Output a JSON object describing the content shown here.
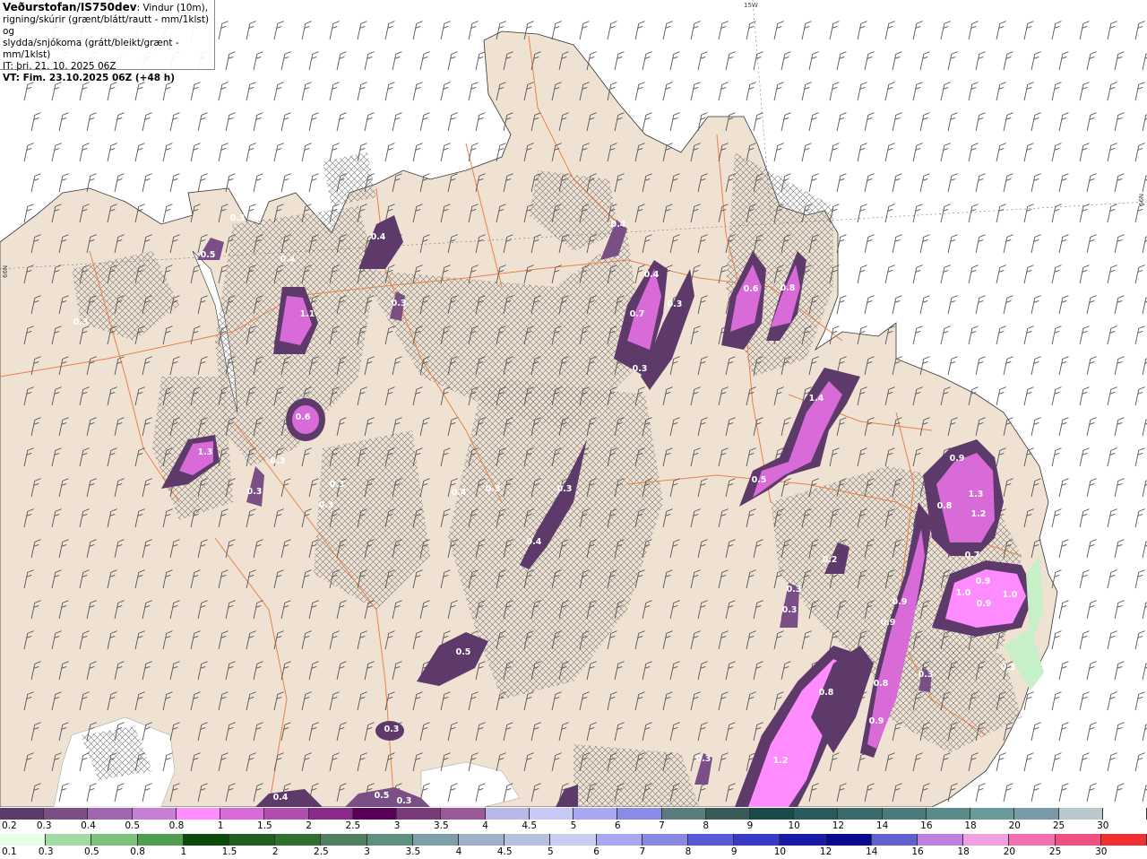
{
  "header": {
    "brand": "Veðurstofan/IS750dev",
    "desc1": ": Vindur (10m),",
    "desc2": "rigning/skúrir (grænt/blátt/rautt - mm/1klst) og",
    "desc3": "slydda/snjókoma (grátt/bleikt/grænt - mm/1klst)",
    "it": "IT: þri. 21. 10. 2025 06Z",
    "vt": "VT: Fim. 23.10.2025 06Z (+48 h)"
  },
  "map": {
    "land_color": "#f0e2d3",
    "sea_color": "#ffffff",
    "road_color": "#e8804a",
    "graticule_labels": {
      "lon": "15W",
      "lat_left": "66N",
      "lat_right": "66N"
    },
    "precip_values": [
      "0.4",
      "0.5",
      "0.3",
      "0.4",
      "1.1",
      "0.3",
      "0.6",
      "1.3",
      "0.3",
      "0.3",
      "0.3",
      "0.3",
      "0.3",
      "0.3",
      "0.4",
      "0.4",
      "0.3",
      "0.4",
      "0.7",
      "0.3",
      "0.3",
      "0.4",
      "0.6",
      "0.8",
      "1.4",
      "0.5",
      "0.9",
      "0.8",
      "1.3",
      "1.2",
      "0.7",
      "0.2",
      "0.3",
      "0.3",
      "0.9",
      "1.0",
      "0.9",
      "1.0",
      "0.9",
      "0.9",
      "0.8",
      "0.9",
      "0.8",
      "0.3",
      "1.2",
      "0.3",
      "0.4",
      "0.5",
      "0.5",
      "0.3",
      "0.3",
      "0.3"
    ]
  },
  "legend_snow": {
    "labels": [
      "0.2",
      "0.3",
      "0.4",
      "0.5",
      "0.8",
      "1",
      "1.5",
      "2",
      "2.5",
      "3",
      "3.5",
      "4",
      "4.5",
      "5",
      "6",
      "7",
      "8",
      "9",
      "10",
      "12",
      "14",
      "16",
      "18",
      "20",
      "25",
      "30"
    ],
    "colors": [
      "#5e3a6a",
      "#7a4f86",
      "#a066b0",
      "#c77fd3",
      "#ff8cff",
      "#d96bd9",
      "#b04fb0",
      "#8a2a8a",
      "#5a005a",
      "#7a3a7a",
      "#9a5a9a",
      "#b7b7e8",
      "#c8c8f4",
      "#a8a8f0",
      "#8a8ae8",
      "#5b7c7c",
      "#3a5a5a",
      "#1a4a4a",
      "#2a5a5a",
      "#3a6a6a",
      "#4a7a7a",
      "#5a8a8a",
      "#6a9a9a",
      "#7a9aa6",
      "#b8c8cc",
      "#ffffff"
    ]
  },
  "legend_rain": {
    "labels": [
      "0.1",
      "0.3",
      "0.5",
      "0.8",
      "1",
      "1.5",
      "2",
      "2.5",
      "3",
      "3.5",
      "4",
      "4.5",
      "5",
      "6",
      "7",
      "8",
      "9",
      "10",
      "12",
      "14",
      "16",
      "18",
      "20",
      "25",
      "30"
    ],
    "colors": [
      "#e6ffe6",
      "#a3dca3",
      "#7cc27c",
      "#4f9f4f",
      "#0a4a0a",
      "#1f5f1f",
      "#2f6f2f",
      "#4f7f5f",
      "#5f8f7f",
      "#7f9fa8",
      "#9fb0c8",
      "#b8c0e0",
      "#c8ccf0",
      "#a8a8f0",
      "#8888e0",
      "#5a5ad8",
      "#3a3ac8",
      "#1a1aa8",
      "#0a0a90",
      "#6060d0",
      "#c080e0",
      "#f0a0e0",
      "#f070b0",
      "#f05080",
      "#f03030",
      "#e00000"
    ]
  }
}
